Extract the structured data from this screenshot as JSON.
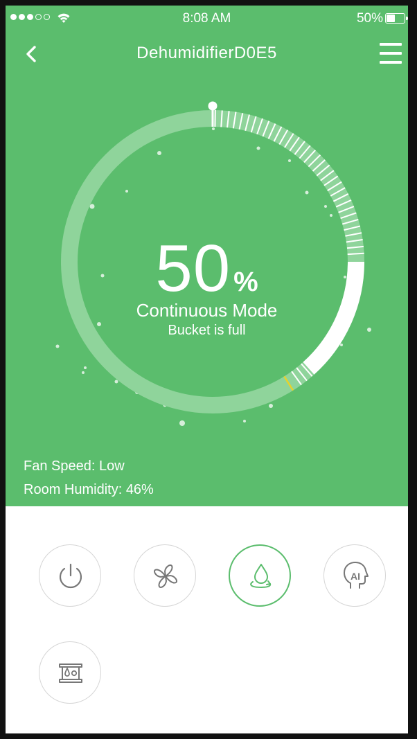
{
  "status_bar": {
    "signal_filled": 3,
    "signal_total": 5,
    "time": "8:08 AM",
    "battery_text": "50%",
    "battery_level": 0.5
  },
  "header": {
    "title": "DehumidifierD0E5"
  },
  "dial": {
    "percent": "50",
    "percent_sign": "%",
    "mode": "Continuous Mode",
    "status": "Bucket is full",
    "level": 0.5
  },
  "info": {
    "fan_speed": "Fan Speed: Low",
    "room_humidity": "Room Humidity: 46%"
  },
  "controls": [
    {
      "icon": "power-icon",
      "active": false
    },
    {
      "icon": "fan-icon",
      "active": false
    },
    {
      "icon": "water-drop-mode-icon",
      "active": true
    },
    {
      "icon": "ai-head-icon",
      "active": false
    },
    {
      "icon": "bucket-filter-icon",
      "active": false
    }
  ],
  "colors": {
    "primary_green": "#5bbd6d",
    "ring_track": "#8fd49b",
    "white": "#ffffff",
    "icon_gray": "#777777",
    "accent_yellow": "#e8d22a"
  }
}
